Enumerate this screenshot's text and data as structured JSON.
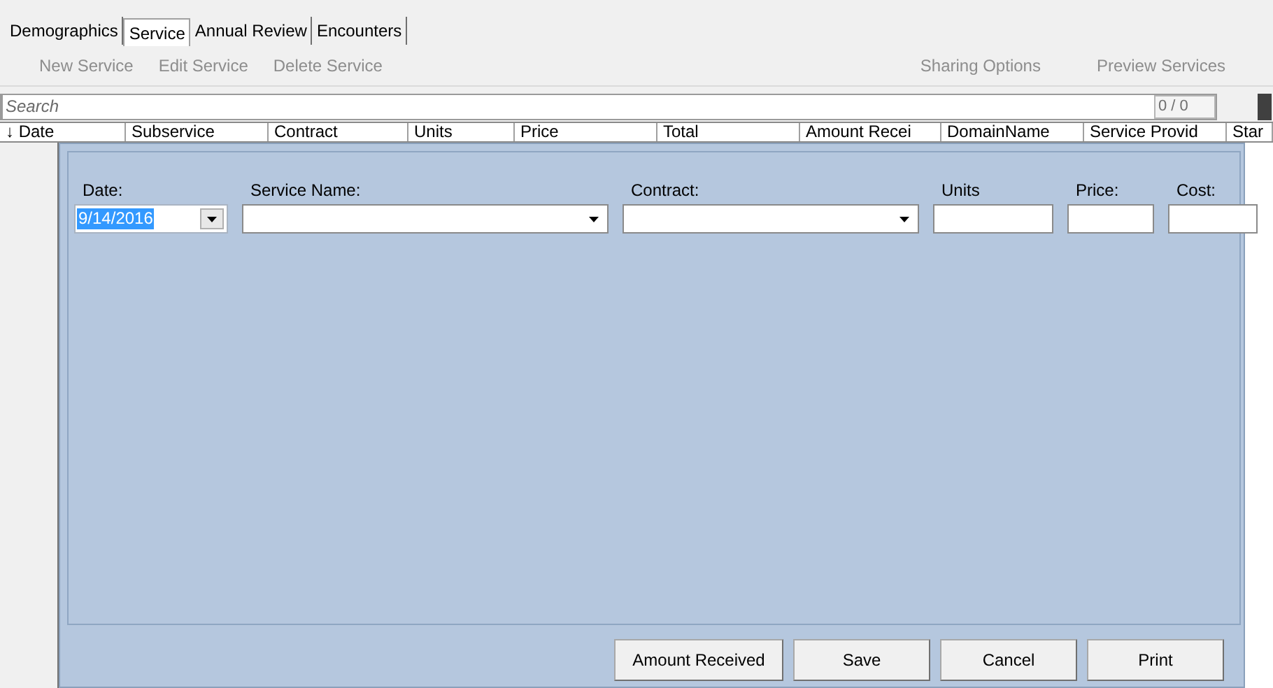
{
  "tabs": [
    {
      "label": "Demographics",
      "selected": false
    },
    {
      "label": "Service",
      "selected": true
    },
    {
      "label": "Annual Review",
      "selected": false
    },
    {
      "label": "Encounters",
      "selected": false
    }
  ],
  "toolbar": {
    "left": [
      {
        "label": "New Service",
        "disabled": true
      },
      {
        "label": "Edit Service",
        "disabled": true
      },
      {
        "label": "Delete Service",
        "disabled": true
      }
    ],
    "right": [
      {
        "label": "Sharing Options",
        "disabled": true
      },
      {
        "label": "Preview Services",
        "disabled": true
      }
    ]
  },
  "search": {
    "placeholder": "Search",
    "counter": "0 / 0"
  },
  "table": {
    "columns": [
      "↓ Date",
      "Subservice",
      "Contract",
      "Units",
      "Price",
      "Total",
      "Amount Recei",
      "DomainName",
      "Service Provid",
      "Star"
    ]
  },
  "form": {
    "fields": [
      {
        "kind": "date",
        "label": "Date:",
        "value": "9/14/2016",
        "text_selected": true
      },
      {
        "kind": "combo",
        "label": "Service Name:"
      },
      {
        "kind": "combo",
        "label": "Contract:"
      },
      {
        "kind": "text",
        "label": "Units"
      },
      {
        "kind": "text",
        "label": "Price:"
      },
      {
        "kind": "text",
        "label": "Cost:"
      }
    ],
    "buttons": [
      "Amount Received",
      "Save",
      "Cancel",
      "Print"
    ]
  }
}
